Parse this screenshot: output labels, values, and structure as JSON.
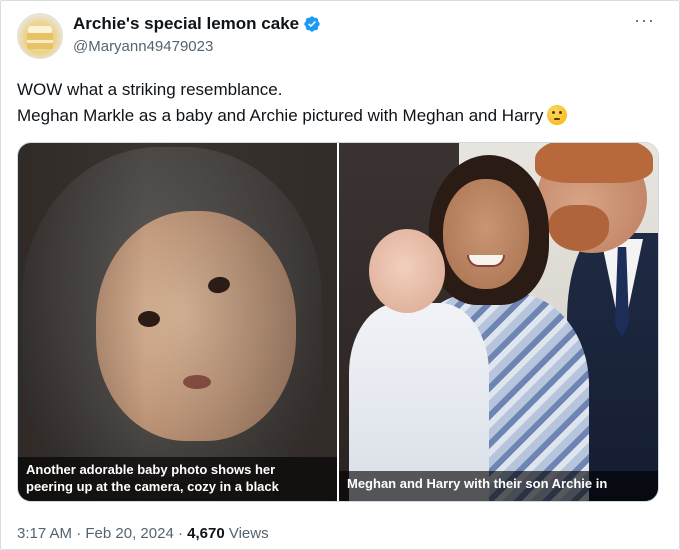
{
  "author": {
    "display_name": "Archie's special lemon cake",
    "handle": "@Maryann49479023",
    "verified": true,
    "avatar_icon": "lemon-cake-avatar"
  },
  "menu_icon": "more-options-icon",
  "tweet": {
    "line1": "WOW what a striking resemblance.",
    "line2": "Meghan Markle as a baby and Archie pictured with Meghan and Harry",
    "emoji": "thinking-face-emoji"
  },
  "media": {
    "left": {
      "caption_line1": "Another adorable baby photo shows her",
      "caption_line2": "peering up at the camera, cozy in a black"
    },
    "right": {
      "caption_line1": "Meghan and Harry with their son Archie in"
    }
  },
  "meta": {
    "time": "3:17 AM",
    "sep1": " · ",
    "date": "Feb 20, 2024",
    "sep2": " · ",
    "views_count": "4,670",
    "views_label": " Views"
  },
  "colors": {
    "text_primary": "#0f1419",
    "text_secondary": "#536471",
    "verified_blue": "#1d9bf0"
  }
}
